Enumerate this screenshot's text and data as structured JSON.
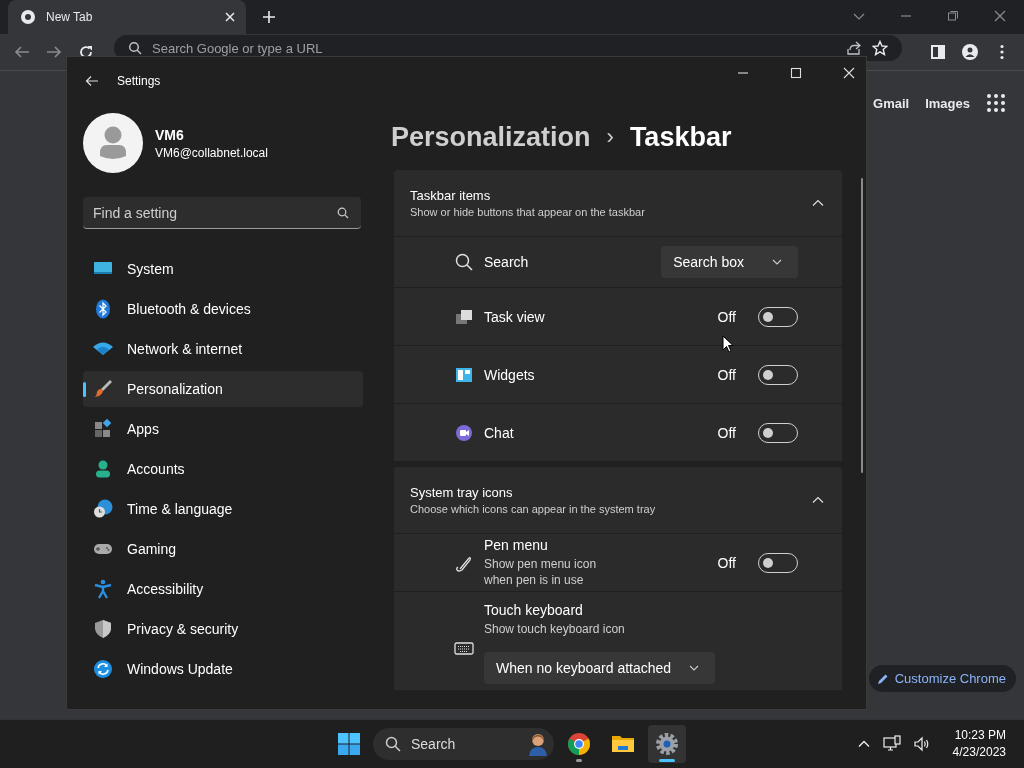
{
  "browser": {
    "tab_title": "New Tab",
    "omnibox_placeholder": "Search Google or type a URL",
    "links": [
      "Gmail",
      "Images"
    ],
    "customize_button": "Customize Chrome"
  },
  "settings": {
    "title": "Settings",
    "user": {
      "name": "VM6",
      "email": "VM6@collabnet.local"
    },
    "search": {
      "placeholder": "Find a setting"
    },
    "nav": [
      {
        "label": "System",
        "selected": false
      },
      {
        "label": "Bluetooth & devices",
        "selected": false
      },
      {
        "label": "Network & internet",
        "selected": false
      },
      {
        "label": "Personalization",
        "selected": true
      },
      {
        "label": "Apps",
        "selected": false
      },
      {
        "label": "Accounts",
        "selected": false
      },
      {
        "label": "Time & language",
        "selected": false
      },
      {
        "label": "Gaming",
        "selected": false
      },
      {
        "label": "Accessibility",
        "selected": false
      },
      {
        "label": "Privacy & security",
        "selected": false
      },
      {
        "label": "Windows Update",
        "selected": false
      }
    ],
    "breadcrumb": {
      "parent": "Personalization",
      "separator": "›",
      "current": "Taskbar"
    },
    "sections": [
      {
        "title": "Taskbar items",
        "description": "Show or hide buttons that appear on the taskbar",
        "expanded": true,
        "rows": [
          {
            "kind": "dropdown",
            "label": "Search",
            "value": "Search box"
          },
          {
            "kind": "toggle",
            "label": "Task view",
            "state_text": "Off",
            "on": false
          },
          {
            "kind": "toggle",
            "label": "Widgets",
            "state_text": "Off",
            "on": false
          },
          {
            "kind": "toggle",
            "label": "Chat",
            "state_text": "Off",
            "on": false
          }
        ]
      },
      {
        "title": "System tray icons",
        "description": "Choose which icons can appear in the system tray",
        "expanded": true,
        "rows": [
          {
            "kind": "toggle",
            "label": "Pen menu",
            "description": "Show pen menu icon when pen is in use",
            "state_text": "Off",
            "on": false
          },
          {
            "kind": "dropdown_below",
            "label": "Touch keyboard",
            "description": "Show touch keyboard icon",
            "value": "When no keyboard attached"
          }
        ]
      }
    ]
  },
  "taskbar": {
    "search_placeholder": "Search",
    "apps": [
      {
        "running": true,
        "selected": false
      },
      {
        "running": false,
        "selected": false
      },
      {
        "running": true,
        "selected": true
      }
    ],
    "time": "10:23 PM",
    "date": "4/23/2023"
  }
}
